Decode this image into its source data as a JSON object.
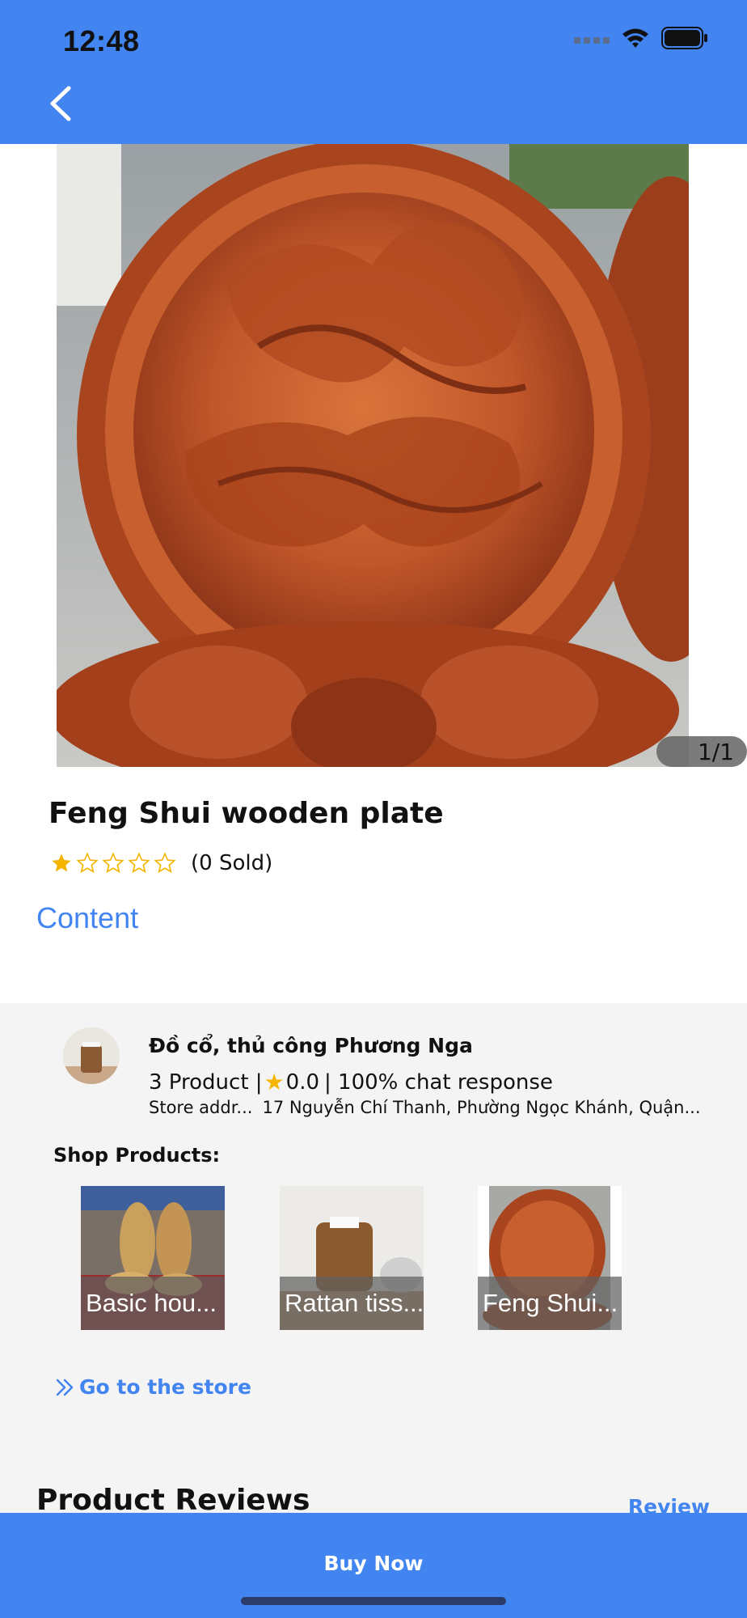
{
  "status_bar": {
    "time": "12:48",
    "icons": [
      "signal-icon",
      "wifi-icon",
      "battery-icon"
    ]
  },
  "header": {
    "back_icon": "chevron-left-icon",
    "background_color": "#4285f0"
  },
  "product": {
    "image_counter": "1/1",
    "title": "Feng Shui wooden plate",
    "rating": 1,
    "rating_max": 5,
    "sold_text": "(0 Sold)",
    "content_link": "Content"
  },
  "shop": {
    "name": "Đồ cổ, thủ công Phương Nga",
    "products_count_text": "3 Product |",
    "rating_text": "0.0",
    "chat_text": "| 100% chat response",
    "address_label": "Store addr...",
    "address_value": "17 Nguyễn Chí Thanh, Phường Ngọc Khánh, Quận...",
    "products_label": "Shop Products:",
    "products": [
      {
        "caption": "Basic hou..."
      },
      {
        "caption": "Rattan tiss..."
      },
      {
        "caption": "Feng Shui..."
      }
    ],
    "go_store_label": "Go to the store"
  },
  "reviews": {
    "title": "Product Reviews",
    "review_link": "Review"
  },
  "bottom_bar": {
    "buy_label": "Buy Now"
  },
  "colors": {
    "accent": "#4285f0",
    "star": "#f4b400"
  }
}
